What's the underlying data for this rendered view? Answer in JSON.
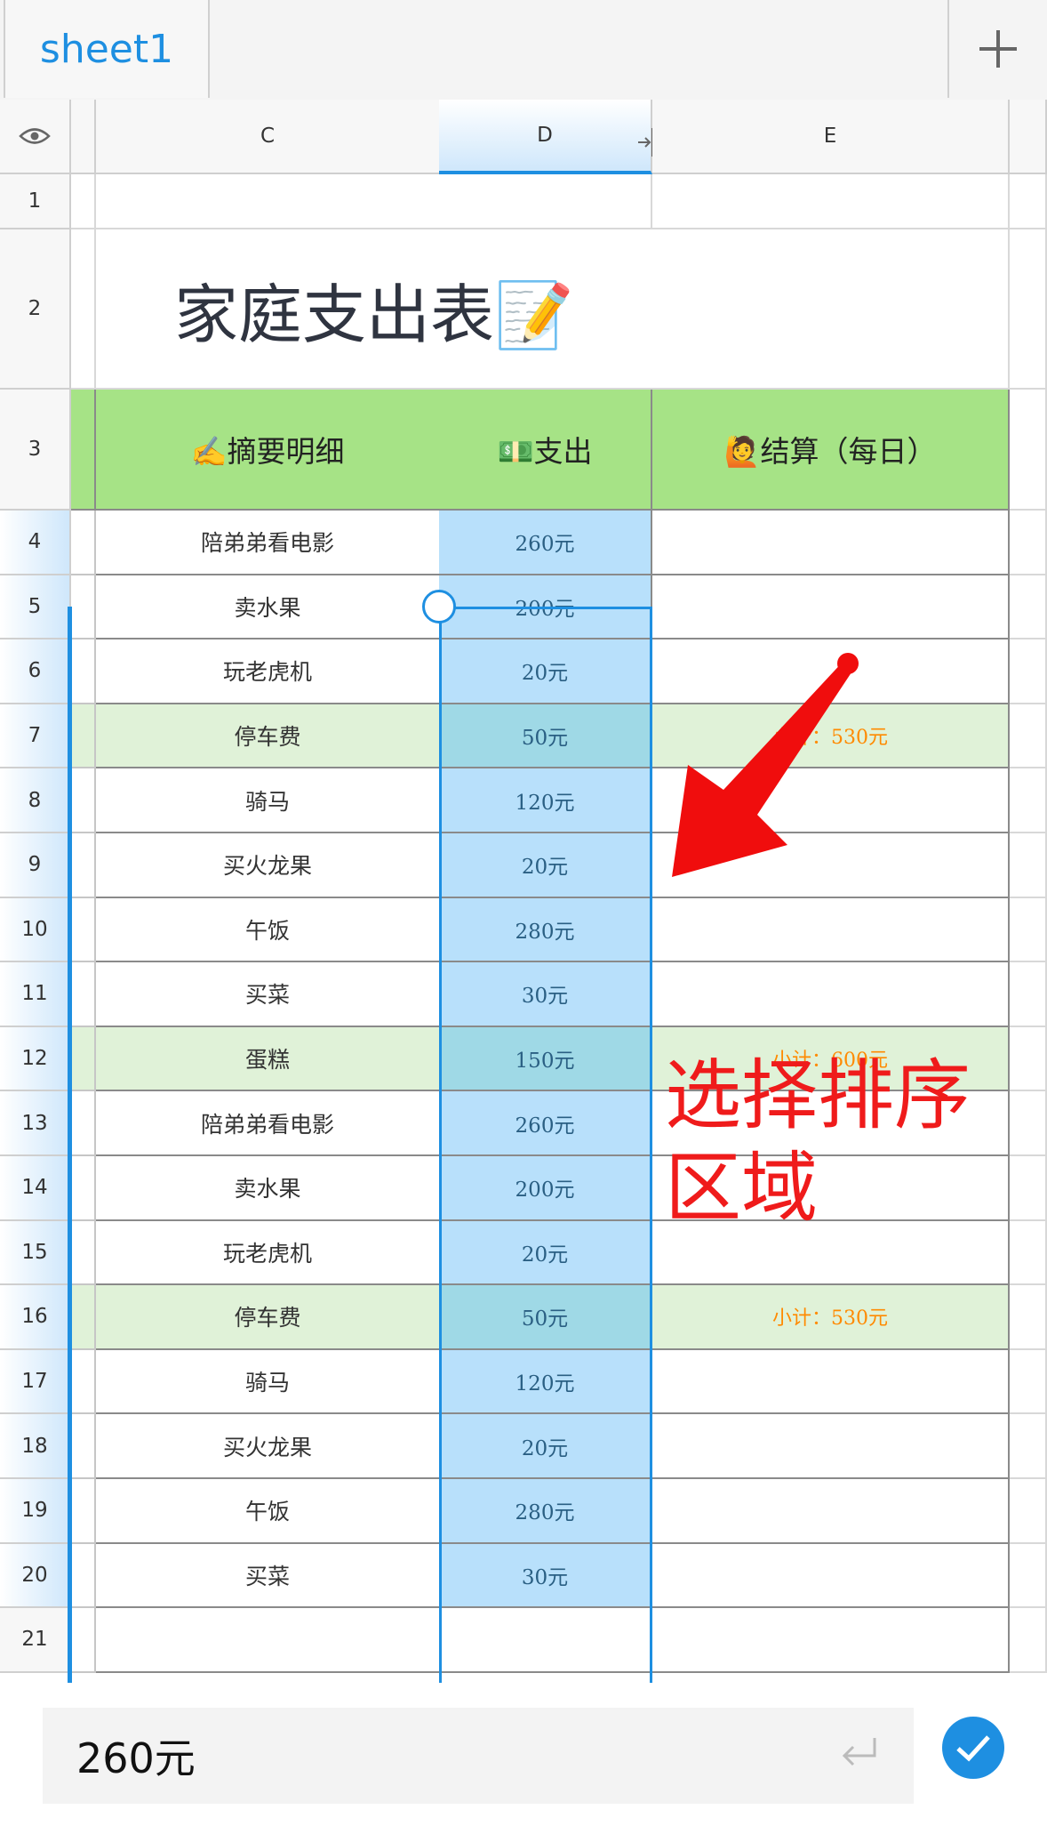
{
  "tabs": {
    "active_label": "sheet1",
    "add_icon": "plus-icon"
  },
  "columns": {
    "visibility_icon": "eye-icon",
    "c": "C",
    "d": "D",
    "e": "E",
    "resize_icon": "column-resize-icon"
  },
  "rows": [
    "1",
    "2",
    "3",
    "4",
    "5",
    "6",
    "7",
    "8",
    "9",
    "10",
    "11",
    "12",
    "13",
    "14",
    "15",
    "16",
    "17",
    "18",
    "19",
    "20",
    "21"
  ],
  "sheet": {
    "title": "家庭支出表📝",
    "headers": {
      "c": "✍️摘要明细",
      "d": "💵支出",
      "e": "🙋结算（每日）"
    },
    "records": [
      {
        "item": "陪弟弟看电影",
        "amount": "260元",
        "settle": ""
      },
      {
        "item": "卖水果",
        "amount": "200元",
        "settle": ""
      },
      {
        "item": "玩老虎机",
        "amount": "20元",
        "settle": ""
      },
      {
        "item": "停车费",
        "amount": "50元",
        "settle": "小计：530元"
      },
      {
        "item": "骑马",
        "amount": "120元",
        "settle": ""
      },
      {
        "item": "买火龙果",
        "amount": "20元",
        "settle": ""
      },
      {
        "item": "午饭",
        "amount": "280元",
        "settle": ""
      },
      {
        "item": "买菜",
        "amount": "30元",
        "settle": ""
      },
      {
        "item": "蛋糕",
        "amount": "150元",
        "settle": "小计：600元"
      },
      {
        "item": "陪弟弟看电影",
        "amount": "260元",
        "settle": ""
      },
      {
        "item": "卖水果",
        "amount": "200元",
        "settle": ""
      },
      {
        "item": "玩老虎机",
        "amount": "20元",
        "settle": ""
      },
      {
        "item": "停车费",
        "amount": "50元",
        "settle": "小计：530元"
      },
      {
        "item": "骑马",
        "amount": "120元",
        "settle": ""
      },
      {
        "item": "买火龙果",
        "amount": "20元",
        "settle": ""
      },
      {
        "item": "午饭",
        "amount": "280元",
        "settle": ""
      },
      {
        "item": "买菜",
        "amount": "30元",
        "settle": ""
      }
    ],
    "highlight_color": "#e0f2d8",
    "header_color": "#a6e386",
    "selection_color": "#b8e0fb"
  },
  "annotation": {
    "text": "选择排序\n区域",
    "color": "#ef1b1b"
  },
  "formula_bar": {
    "value": "260元",
    "enter_icon": "enter-icon",
    "confirm_icon": "checkmark-icon"
  },
  "accent_color": "#1e8fe1"
}
